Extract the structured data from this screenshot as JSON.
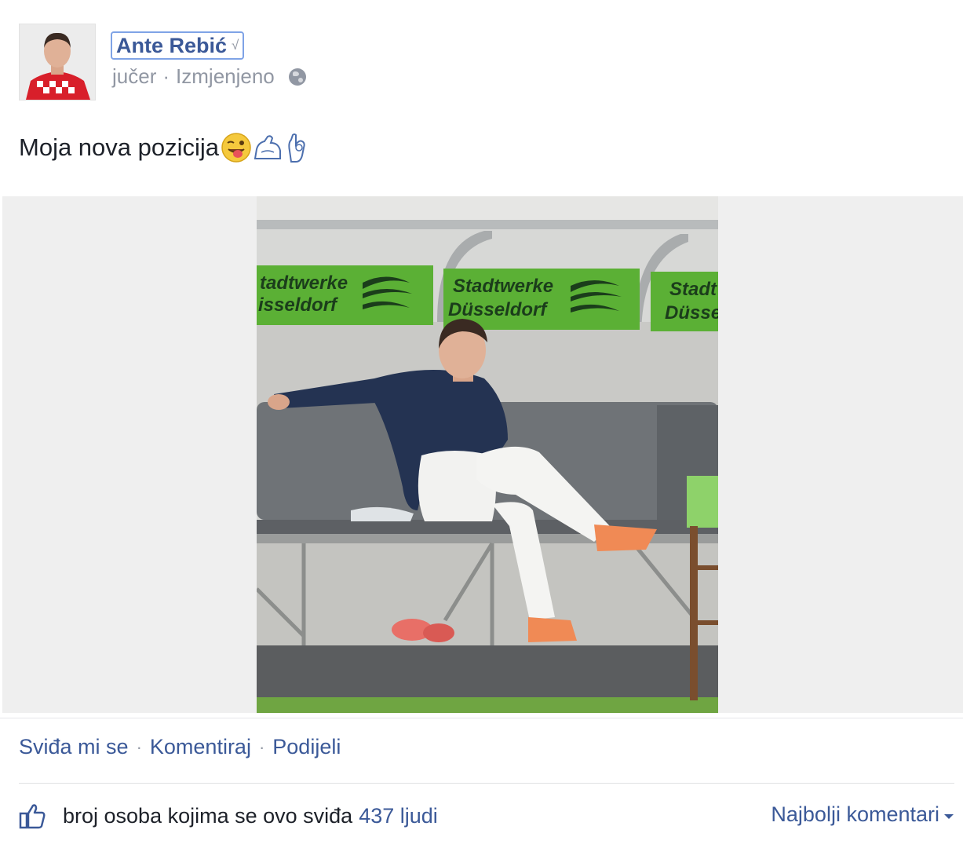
{
  "post": {
    "author": "Ante Rebić",
    "timestamp": "jučer",
    "meta_separator": "·",
    "edited_label": "Izmjenjeno",
    "audience_icon": "globe-icon",
    "text": "Moja nova pozicija",
    "emojis": [
      "tongue-wink-icon",
      "flexed-biceps-icon",
      "ok-hand-icon"
    ]
  },
  "photo": {
    "sponsor_text_line1": "Stadtwerke",
    "sponsor_text_line2": "Düsseldorf",
    "colors": {
      "sponsor_green": "#5bb035",
      "bench": "#6f7377",
      "shirt": "#243352"
    }
  },
  "actions": {
    "like": "Sviđa mi se",
    "comment": "Komentiraj",
    "share": "Podijeli",
    "separator": "·"
  },
  "likes": {
    "icon": "thumbs-up-icon",
    "label": "broj osoba kojima se ovo sviđa",
    "count": "437 ljudi"
  },
  "comments_sort": {
    "label": "Najbolji komentari"
  },
  "colors": {
    "link": "#3b5998",
    "muted": "#9197a3",
    "text": "#1d2129",
    "photo_background": "#efefef"
  }
}
